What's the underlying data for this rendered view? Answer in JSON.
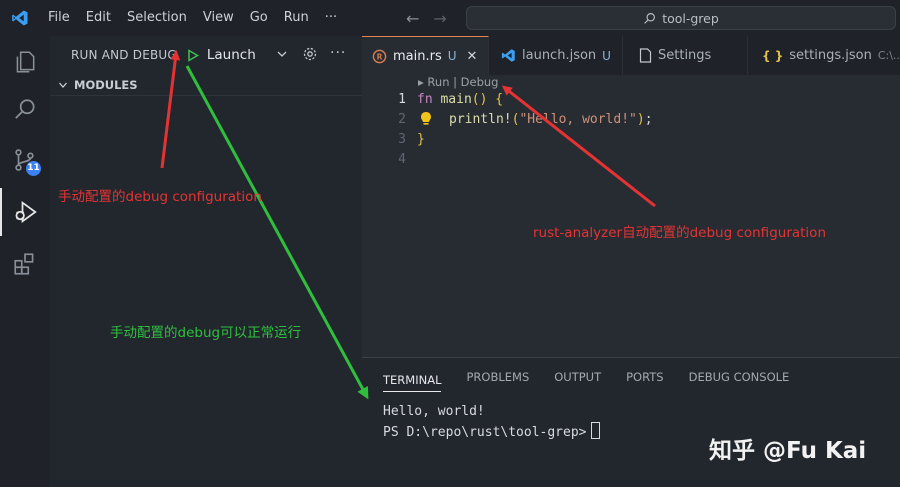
{
  "menu": [
    "File",
    "Edit",
    "Selection",
    "View",
    "Go",
    "Run",
    "···"
  ],
  "search": {
    "text": "tool-grep"
  },
  "activity": {
    "source_control_badge": "11"
  },
  "sidebar": {
    "title": "RUN AND DEBUG",
    "launch_label": "Launch",
    "modules_label": "MODULES"
  },
  "tabs": [
    {
      "label": "main.rs",
      "status": "U"
    },
    {
      "label": "launch.json",
      "status": "U"
    },
    {
      "label": "Settings"
    },
    {
      "label": "settings.json",
      "path": "C:\\..."
    }
  ],
  "editor": {
    "codelens": "▸ Run | Debug",
    "line_numbers": [
      "1",
      "2",
      "3",
      "4"
    ]
  },
  "panel": {
    "tabs": [
      "TERMINAL",
      "PROBLEMS",
      "OUTPUT",
      "PORTS",
      "DEBUG CONSOLE"
    ],
    "terminal_lines": [
      "Hello, world!",
      "PS D:\\repo\\rust\\tool-grep>"
    ]
  },
  "annotations": {
    "manual_config": "手动配置的debug configuration",
    "rust_analyzer": "rust-analyzer自动配置的debug configuration",
    "manual_works": "手动配置的debug可以正常运行"
  },
  "watermark": "知乎 @Fu Kai",
  "colors": {
    "background": "#1f2329",
    "annotation_red": "#e53333",
    "annotation_green": "#2fbf3d",
    "accent_blue": "#3b82f6"
  }
}
